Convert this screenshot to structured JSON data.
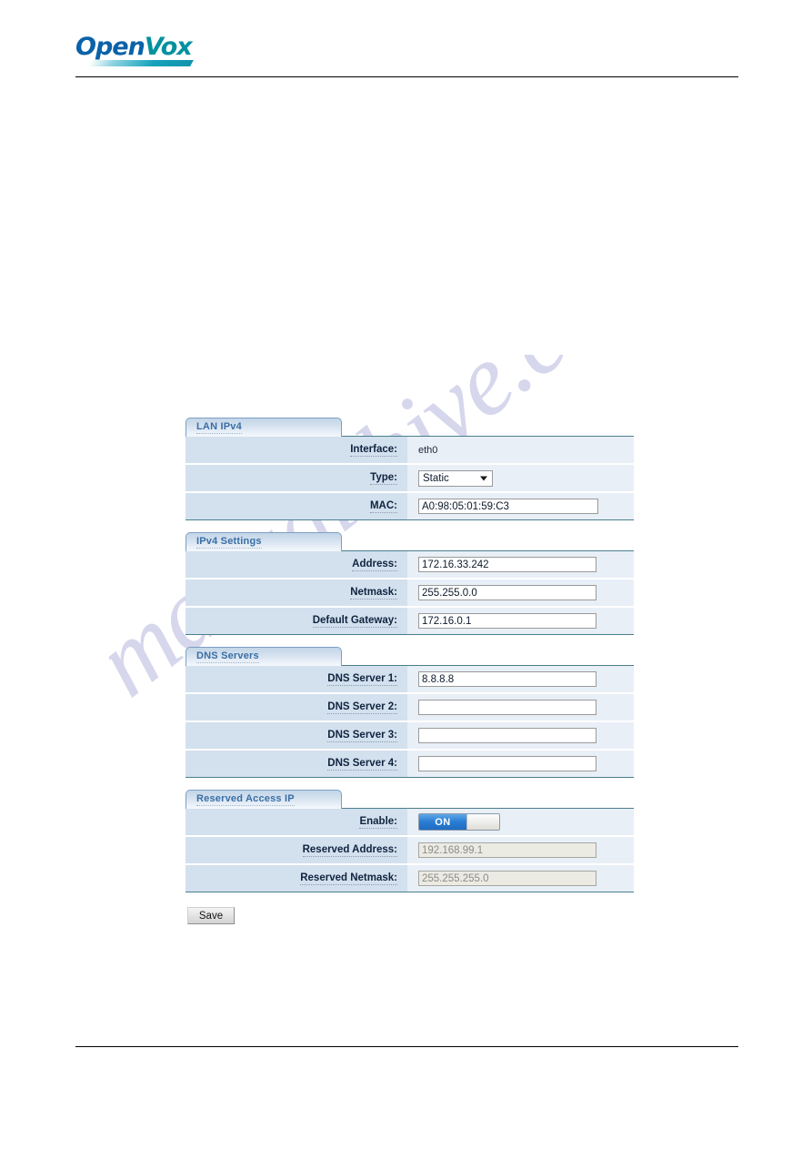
{
  "header": {
    "logo_open": "Open",
    "logo_vox": "Vox"
  },
  "watermark": {
    "text": "manualshive.com"
  },
  "panels": [
    {
      "title": "LAN IPv4",
      "rows": [
        {
          "label": "Interface:",
          "kind": "static",
          "value": "eth0"
        },
        {
          "label": "Type:",
          "kind": "select",
          "value": "Static"
        },
        {
          "label": "MAC:",
          "kind": "input",
          "value": "A0:98:05:01:59:C3"
        }
      ]
    },
    {
      "title": "IPv4 Settings",
      "rows": [
        {
          "label": "Address:",
          "kind": "input",
          "value": "172.16.33.242"
        },
        {
          "label": "Netmask:",
          "kind": "input",
          "value": "255.255.0.0"
        },
        {
          "label": "Default Gateway:",
          "kind": "input",
          "value": "172.16.0.1"
        }
      ]
    },
    {
      "title": "DNS Servers",
      "rows": [
        {
          "label": "DNS Server 1:",
          "kind": "input",
          "value": "8.8.8.8"
        },
        {
          "label": "DNS Server 2:",
          "kind": "input",
          "value": ""
        },
        {
          "label": "DNS Server 3:",
          "kind": "input",
          "value": ""
        },
        {
          "label": "DNS Server 4:",
          "kind": "input",
          "value": ""
        }
      ]
    },
    {
      "title": "Reserved Access IP",
      "rows": [
        {
          "label": "Enable:",
          "kind": "toggle",
          "value": "ON"
        },
        {
          "label": "Reserved Address:",
          "kind": "input-disabled",
          "value": "192.168.99.1"
        },
        {
          "label": "Reserved Netmask:",
          "kind": "input-disabled",
          "value": "255.255.255.0"
        }
      ]
    }
  ],
  "buttons": {
    "save": "Save"
  },
  "colors": {
    "logo_open": "#0a62a8",
    "logo_vox": "#01919f",
    "tab_text": "#3a6ea5",
    "label_cell": "#d3e0ee",
    "value_cell": "#e9eff7",
    "toggle_on": "#2a7ed4",
    "watermark": "#cfcfe9"
  }
}
